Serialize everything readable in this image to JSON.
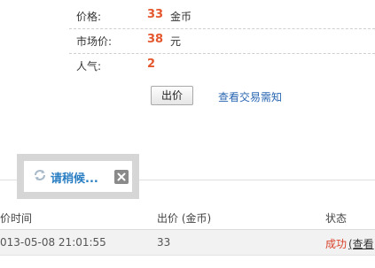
{
  "info": {
    "price": {
      "label": "价格:",
      "value": "33",
      "unit": "金币"
    },
    "market_price": {
      "label": "市场价:",
      "value": "38",
      "unit": "元"
    },
    "popularity": {
      "label": "人气:",
      "value": "2"
    }
  },
  "actions": {
    "bid_label": "出价",
    "rules_link": "查看交易需知"
  },
  "loading": {
    "text": "请稍候...",
    "spinner_icon": "refresh-icon",
    "close_icon": "close-icon"
  },
  "table": {
    "headers": [
      "价时间",
      "出价 (金币)",
      "状态"
    ],
    "rows": [
      {
        "time": "013-05-08 21:01:55",
        "bid": "33",
        "status": "成功",
        "action": "(查看"
      }
    ]
  },
  "colors": {
    "accent_value": "#e4572e",
    "link": "#2a66b2",
    "loading_text": "#2a7ec2",
    "success": "#d9432b"
  }
}
